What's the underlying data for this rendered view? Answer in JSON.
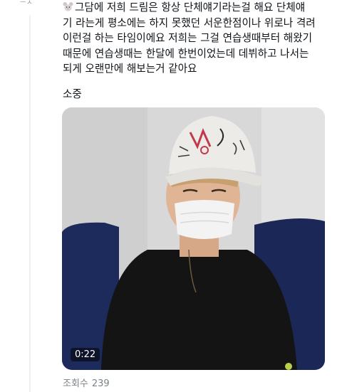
{
  "gutter": {
    "avatar_stub": "ㅡㅅ"
  },
  "tweet": {
    "emoji_icon": "mouse-face-icon",
    "lines": [
      "그담에 저희 드림은 항상 단체얘기라는걸 해요 단체얘",
      "기 라는게 평소에는 하지 못했던 서운한점이나 위로나 격려",
      "이런걸 하는 타임이에요 저희는 그걸 연습생때부터 해왔기",
      "때문에 연습생때는 한달에 한번이었는데 데뷔하고 나서는",
      "되게 오랜만에 해보는거 같아요"
    ],
    "signature": "소중"
  },
  "media": {
    "type": "video",
    "duration": "0:22",
    "colors": {
      "wall": "#d9d9d9",
      "chair": "#1d2a5c",
      "shirt": "#141414",
      "cap": "#ecebe8",
      "mask": "#f3f3f3"
    }
  },
  "footer": {
    "views_label": "조회수",
    "views_count": "239"
  }
}
